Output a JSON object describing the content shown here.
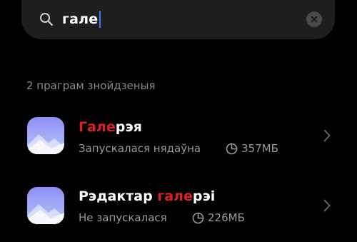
{
  "search": {
    "query": "гале"
  },
  "results": {
    "count_label": "2 праграм знойдзеныя",
    "items": [
      {
        "name_highlight": "Гале",
        "name_rest_before": "",
        "name_rest_after": "рэя",
        "status": "Запускалася нядаўна",
        "size": "357МБ",
        "icon": "gallery-app-icon"
      },
      {
        "name_highlight": "гале",
        "name_rest_before": "Рэдактар ",
        "name_rest_after": "рэі",
        "status": "Не запускалася",
        "size": "226МБ",
        "icon": "gallery-editor-app-icon"
      }
    ]
  },
  "colors": {
    "background": "#000000",
    "search_bar": "#1e1e1e",
    "highlight": "#e02020",
    "caret": "#2f7bf2",
    "secondary_text": "#9a9a9a"
  }
}
